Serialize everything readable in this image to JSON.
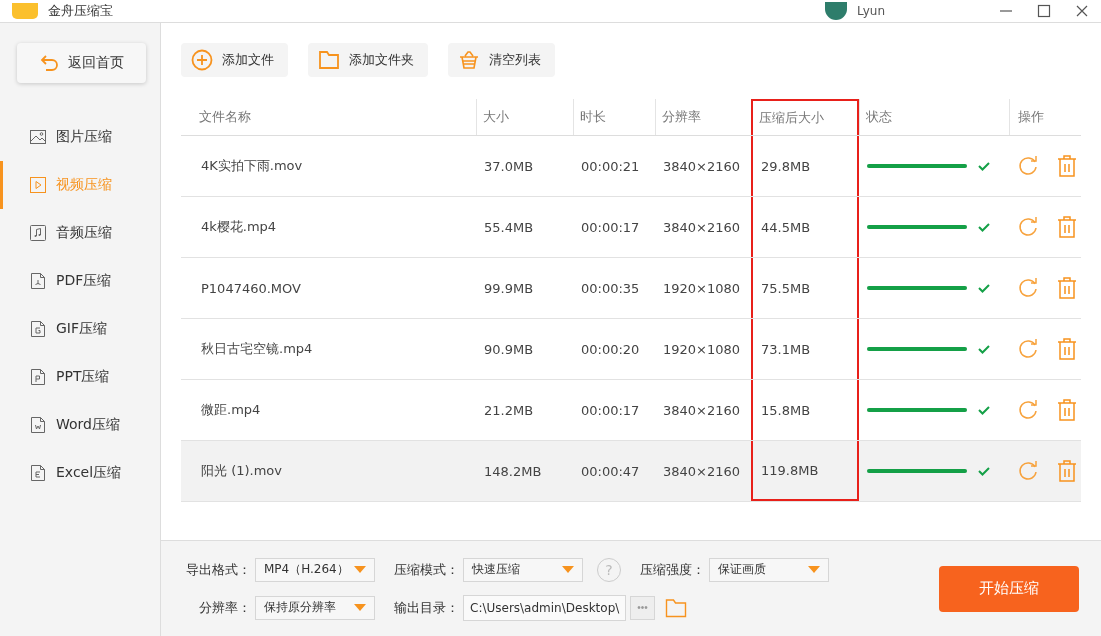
{
  "window": {
    "title": "金舟压缩宝",
    "user": "Lyun"
  },
  "sidebar": {
    "home_button": "返回首页",
    "items": [
      {
        "label": "图片压缩",
        "selected": false
      },
      {
        "label": "视频压缩",
        "selected": true
      },
      {
        "label": "音频压缩",
        "selected": false
      },
      {
        "label": "PDF压缩",
        "selected": false
      },
      {
        "label": "GIF压缩",
        "selected": false
      },
      {
        "label": "PPT压缩",
        "selected": false
      },
      {
        "label": "Word压缩",
        "selected": false
      },
      {
        "label": "Excel压缩",
        "selected": false
      }
    ]
  },
  "toolbar": [
    {
      "label": "添加文件"
    },
    {
      "label": "添加文件夹"
    },
    {
      "label": "清空列表"
    }
  ],
  "table": {
    "columns": [
      {
        "label": "文件名称",
        "highlighted": false
      },
      {
        "label": "大小",
        "highlighted": false
      },
      {
        "label": "时长",
        "highlighted": false
      },
      {
        "label": "分辨率",
        "highlighted": false
      },
      {
        "label": "压缩后大小",
        "highlighted": true
      },
      {
        "label": "状态",
        "highlighted": false
      },
      {
        "label": "操作",
        "highlighted": false
      }
    ],
    "rows": [
      {
        "name": "4K实拍下雨.mov",
        "size": "37.0MB",
        "duration": "00:00:21",
        "resolution": "3840×2160",
        "compressed": "29.8MB",
        "level": 1,
        "done": true,
        "selected": false
      },
      {
        "name": "4k樱花.mp4",
        "size": "55.4MB",
        "duration": "00:00:17",
        "resolution": "3840×2160",
        "compressed": "44.5MB",
        "level": 1,
        "done": true,
        "selected": false
      },
      {
        "name": "P1047460.MOV",
        "size": "99.9MB",
        "duration": "00:00:35",
        "resolution": "1920×1080",
        "compressed": "75.5MB",
        "level": 1,
        "done": true,
        "selected": false
      },
      {
        "name": "秋日古宅空镜.mp4",
        "size": "90.9MB",
        "duration": "00:00:20",
        "resolution": "1920×1080",
        "compressed": "73.1MB",
        "level": 1,
        "done": true,
        "selected": false
      },
      {
        "name": "微距.mp4",
        "size": "21.2MB",
        "duration": "00:00:17",
        "resolution": "3840×2160",
        "compressed": "15.8MB",
        "level": 1,
        "done": true,
        "selected": false
      },
      {
        "name": "阳光 (1).mov",
        "size": "148.2MB",
        "duration": "00:00:47",
        "resolution": "3840×2160",
        "compressed": "119.8MB",
        "level": 1,
        "done": true,
        "selected": true
      }
    ]
  },
  "settings": [
    {
      "label": "导出格式：",
      "value": "MP4（H.264）",
      "kind": "dropdown"
    },
    {
      "label": "压缩模式：",
      "value": "快速压缩",
      "kind": "dropdown",
      "help": "?"
    },
    {
      "label": "压缩强度：",
      "value": "保证画质",
      "kind": "dropdown"
    },
    {
      "label": "分辨率：",
      "value": "保持原分辨率",
      "kind": "dropdown"
    },
    {
      "label": "输出目录：",
      "value": "C:\\Users\\admin\\Desktop\\",
      "kind": "path",
      "browse": "•••"
    }
  ],
  "start_button": "开始压缩"
}
